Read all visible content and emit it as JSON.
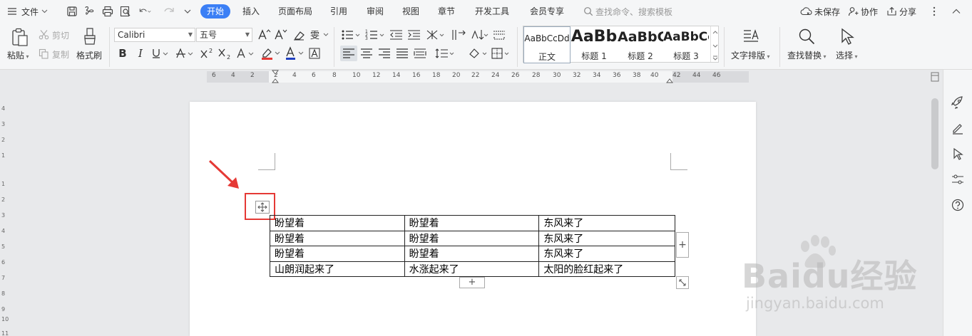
{
  "menubar": {
    "file_label": "文件",
    "tabs": [
      {
        "label": "开始",
        "active": true
      },
      {
        "label": "插入"
      },
      {
        "label": "页面布局"
      },
      {
        "label": "引用"
      },
      {
        "label": "审阅"
      },
      {
        "label": "视图"
      },
      {
        "label": "章节"
      },
      {
        "label": "开发工具"
      },
      {
        "label": "会员专享"
      }
    ],
    "search_placeholder": "查找命令、搜索模板",
    "unsaved_label": "未保存",
    "collab_label": "协作",
    "share_label": "分享"
  },
  "ribbon": {
    "paste_label": "粘贴",
    "cut_label": "剪切",
    "copy_label": "复制",
    "format_painter_label": "格式刷",
    "font_name": "Calibri",
    "font_size": "五号",
    "styles": [
      {
        "preview": "AaBbCcDd",
        "caption": "正文"
      },
      {
        "preview": "AaBb",
        "caption": "标题 1"
      },
      {
        "preview": "AaBbC",
        "caption": "标题 2"
      },
      {
        "preview": "AaBbCc",
        "caption": "标题 3"
      }
    ],
    "text_layout_label": "文字排版",
    "find_replace_label": "查找替换",
    "select_label": "选择"
  },
  "ruler": {
    "h_marks": [
      "6",
      "4",
      "2",
      "2",
      "4",
      "6",
      "8",
      "10",
      "12",
      "14",
      "16",
      "18",
      "20",
      "22",
      "24",
      "26",
      "28",
      "30",
      "32",
      "34",
      "36",
      "38",
      "40",
      "42",
      "44",
      "46"
    ],
    "v_marks": [
      "4",
      "3",
      "2",
      "1",
      "1",
      "2",
      "3",
      "4",
      "5",
      "6",
      "7",
      "8",
      "9",
      "10",
      "11"
    ]
  },
  "table": {
    "rows": [
      [
        "盼望着",
        "盼望着",
        "东风来了"
      ],
      [
        "盼望着",
        "盼望着",
        "东风来了"
      ],
      [
        "盼望着",
        "盼望着",
        "东风来了"
      ],
      [
        "山朗润起来了",
        "水涨起来了",
        "太阳的脸红起来了"
      ]
    ],
    "add_symbol": "+"
  },
  "watermark": {
    "brand": "Baidu经验",
    "url": "jingyan.baidu.com"
  },
  "colors": {
    "accent": "#3b7ff5",
    "annotation_red": "#e53935",
    "font_color_underline": "#2040c0",
    "highlight_underline": "#e53935"
  }
}
